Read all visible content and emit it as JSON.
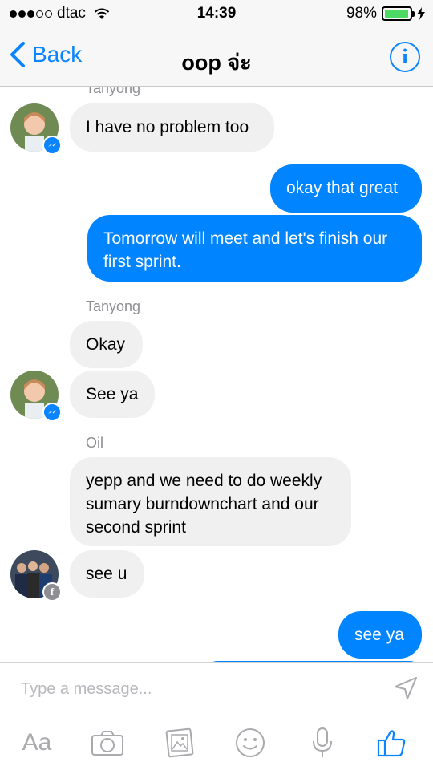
{
  "status_bar": {
    "carrier": "dtac",
    "time": "14:39",
    "battery": "98%",
    "battery_level": 0.98
  },
  "nav": {
    "back_label": "Back",
    "title": "oop จ่ะ",
    "info_label": "i"
  },
  "messages": [
    {
      "sender": "Tanyong",
      "direction": "in",
      "text": "I have no problem too"
    },
    {
      "direction": "out",
      "text": "okay that great"
    },
    {
      "direction": "out",
      "text": "Tomorrow will meet and let's finish our first sprint."
    },
    {
      "sender": "Tanyong",
      "direction": "in",
      "text": "Okay"
    },
    {
      "direction": "in",
      "text": "See ya"
    },
    {
      "sender": "Oil",
      "direction": "in",
      "text": "yepp and we need to do weekly sumary burndownchart and our second sprint"
    },
    {
      "direction": "in",
      "text": "see u"
    },
    {
      "direction": "out",
      "text": "see ya"
    }
  ],
  "composer": {
    "placeholder": "Type a message...",
    "tools": {
      "aa_label": "Aa",
      "camera": "camera-icon",
      "gallery": "gallery-icon",
      "emoji": "emoji-icon",
      "mic": "microphone-icon",
      "like": "thumbs-up-icon"
    }
  },
  "colors": {
    "accent": "#0084ff",
    "incoming_bubble": "#f1f0f0",
    "battery_fill": "#4cd964"
  }
}
